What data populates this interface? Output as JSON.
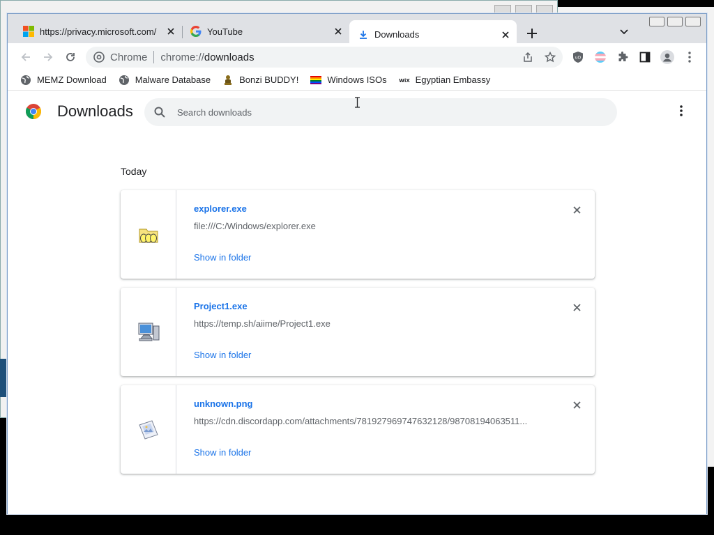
{
  "tabs": [
    {
      "title": "https://privacy.microsoft.com/",
      "favicon": "microsoft-icon",
      "active": false
    },
    {
      "title": "YouTube",
      "favicon": "google-icon",
      "active": false
    },
    {
      "title": "Downloads",
      "favicon": "download-icon",
      "active": true
    }
  ],
  "omnibox": {
    "chip": "Chrome",
    "scheme": "chrome://",
    "host": "downloads"
  },
  "bookmarks": [
    {
      "label": "MEMZ Download",
      "icon": "globe-icon"
    },
    {
      "label": "Malware Database",
      "icon": "globe-icon"
    },
    {
      "label": "Bonzi BUDDY!",
      "icon": "bonzi-icon"
    },
    {
      "label": "Windows ISOs",
      "icon": "rainbow-flag-icon"
    },
    {
      "label": "Egyptian Embassy",
      "icon": "wix-icon"
    }
  ],
  "page": {
    "title": "Downloads",
    "search_placeholder": "Search downloads",
    "date_heading": "Today"
  },
  "downloads": [
    {
      "name": "explorer.exe",
      "url": "file:///C:/Windows/explorer.exe",
      "action": "Show in folder",
      "icon": "explorer-folder-icon"
    },
    {
      "name": "Project1.exe",
      "url": "https://temp.sh/aiime/Project1.exe",
      "action": "Show in folder",
      "icon": "computer-icon"
    },
    {
      "name": "unknown.png",
      "url": "https://cdn.discordapp.com/attachments/781927969747632128/98708194063511...",
      "action": "Show in folder",
      "icon": "image-file-icon"
    }
  ],
  "colors": {
    "accent": "#1a73e8",
    "tabstrip": "#dfe1e5",
    "omnibox": "#f1f3f4"
  }
}
